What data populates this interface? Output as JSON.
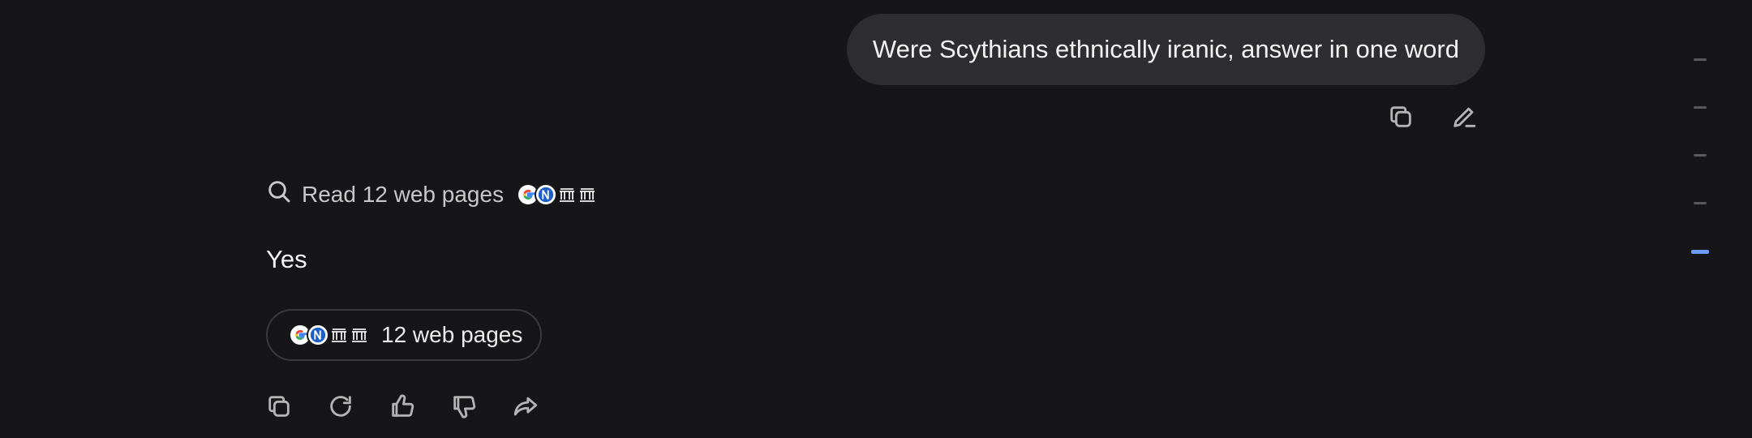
{
  "user_message": {
    "text": "Were Scythians ethnically iranic, answer in one word"
  },
  "user_actions": [
    {
      "name": "copy",
      "icon": "copy-icon"
    },
    {
      "name": "edit",
      "icon": "edit-pencil-icon"
    }
  ],
  "assistant": {
    "search_status": "Read 12 web pages",
    "answer": "Yes",
    "sources_label": "12 web pages",
    "favicons": [
      "google-favicon",
      "blue-site-favicon",
      "institution-favicon",
      "institution-favicon"
    ]
  },
  "assistant_actions": [
    {
      "name": "copy",
      "icon": "copy-icon"
    },
    {
      "name": "regenerate",
      "icon": "refresh-icon"
    },
    {
      "name": "like",
      "icon": "thumbs-up-icon"
    },
    {
      "name": "dislike",
      "icon": "thumbs-down-icon"
    },
    {
      "name": "share",
      "icon": "share-icon"
    }
  ],
  "scroll_markers": {
    "count": 5,
    "active_index": 4,
    "active_color": "#6d9cf5"
  }
}
